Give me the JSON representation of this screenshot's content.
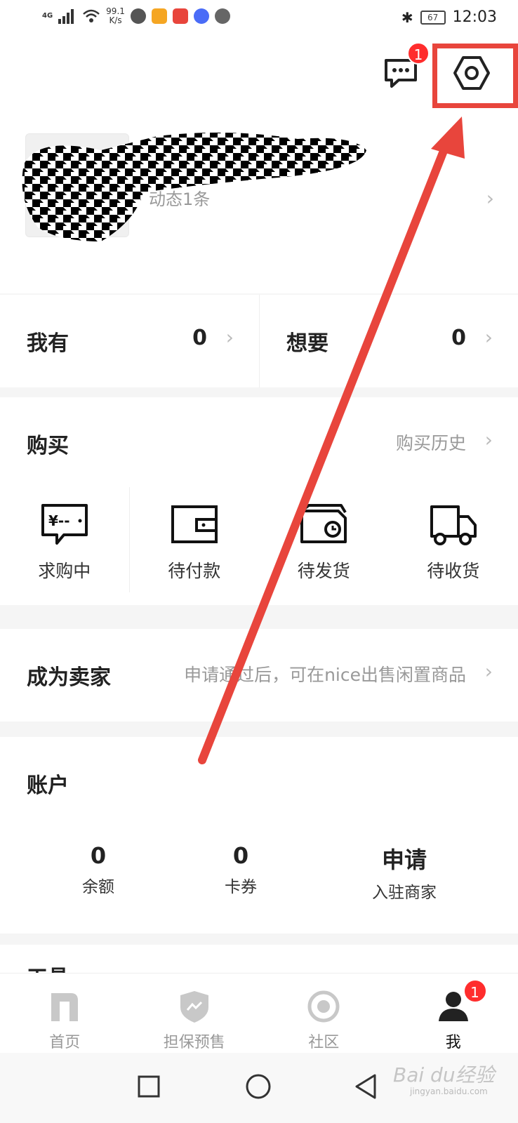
{
  "status_bar": {
    "network": "4G",
    "speed": "99.1",
    "speed_unit": "K/s",
    "battery": "67",
    "time": "12:03",
    "app_colors": [
      "#555555",
      "#f5a623",
      "#e8453c",
      "#4a6cf7",
      "#666666"
    ]
  },
  "header": {
    "message_badge": "1",
    "message_icon": "chat-bubble-icon",
    "settings_icon": "hexagon-settings-icon"
  },
  "profile": {
    "subtitle": "动态1条"
  },
  "stats": {
    "owned_label": "我有",
    "owned_value": "0",
    "wanted_label": "想要",
    "wanted_value": "0"
  },
  "purchase": {
    "title": "购买",
    "history_link": "购买历史",
    "items": [
      {
        "label": "求购中",
        "icon": "wanted-tag-icon"
      },
      {
        "label": "待付款",
        "icon": "wallet-icon"
      },
      {
        "label": "待发货",
        "icon": "box-clock-icon"
      },
      {
        "label": "待收货",
        "icon": "truck-icon"
      }
    ]
  },
  "seller": {
    "title": "成为卖家",
    "desc": "申请通过后，可在nice出售闲置商品"
  },
  "account": {
    "title": "账户",
    "balance_value": "0",
    "balance_label": "余额",
    "coupon_value": "0",
    "coupon_label": "卡券",
    "apply_value": "申请",
    "apply_label": "入驻商家"
  },
  "tools": {
    "title": "工具"
  },
  "tabbar": {
    "items": [
      {
        "label": "首页",
        "icon": "n-logo-icon"
      },
      {
        "label": "担保预售",
        "icon": "shield-icon"
      },
      {
        "label": "社区",
        "icon": "circle-target-icon"
      },
      {
        "label": "我",
        "icon": "user-icon"
      }
    ],
    "me_badge": "1",
    "active_color": "#111111",
    "inactive_color": "#999999"
  },
  "watermark": {
    "brand": "Bai du经验",
    "url": "jingyan.baidu.com"
  },
  "annotation_color": "#e8453c"
}
